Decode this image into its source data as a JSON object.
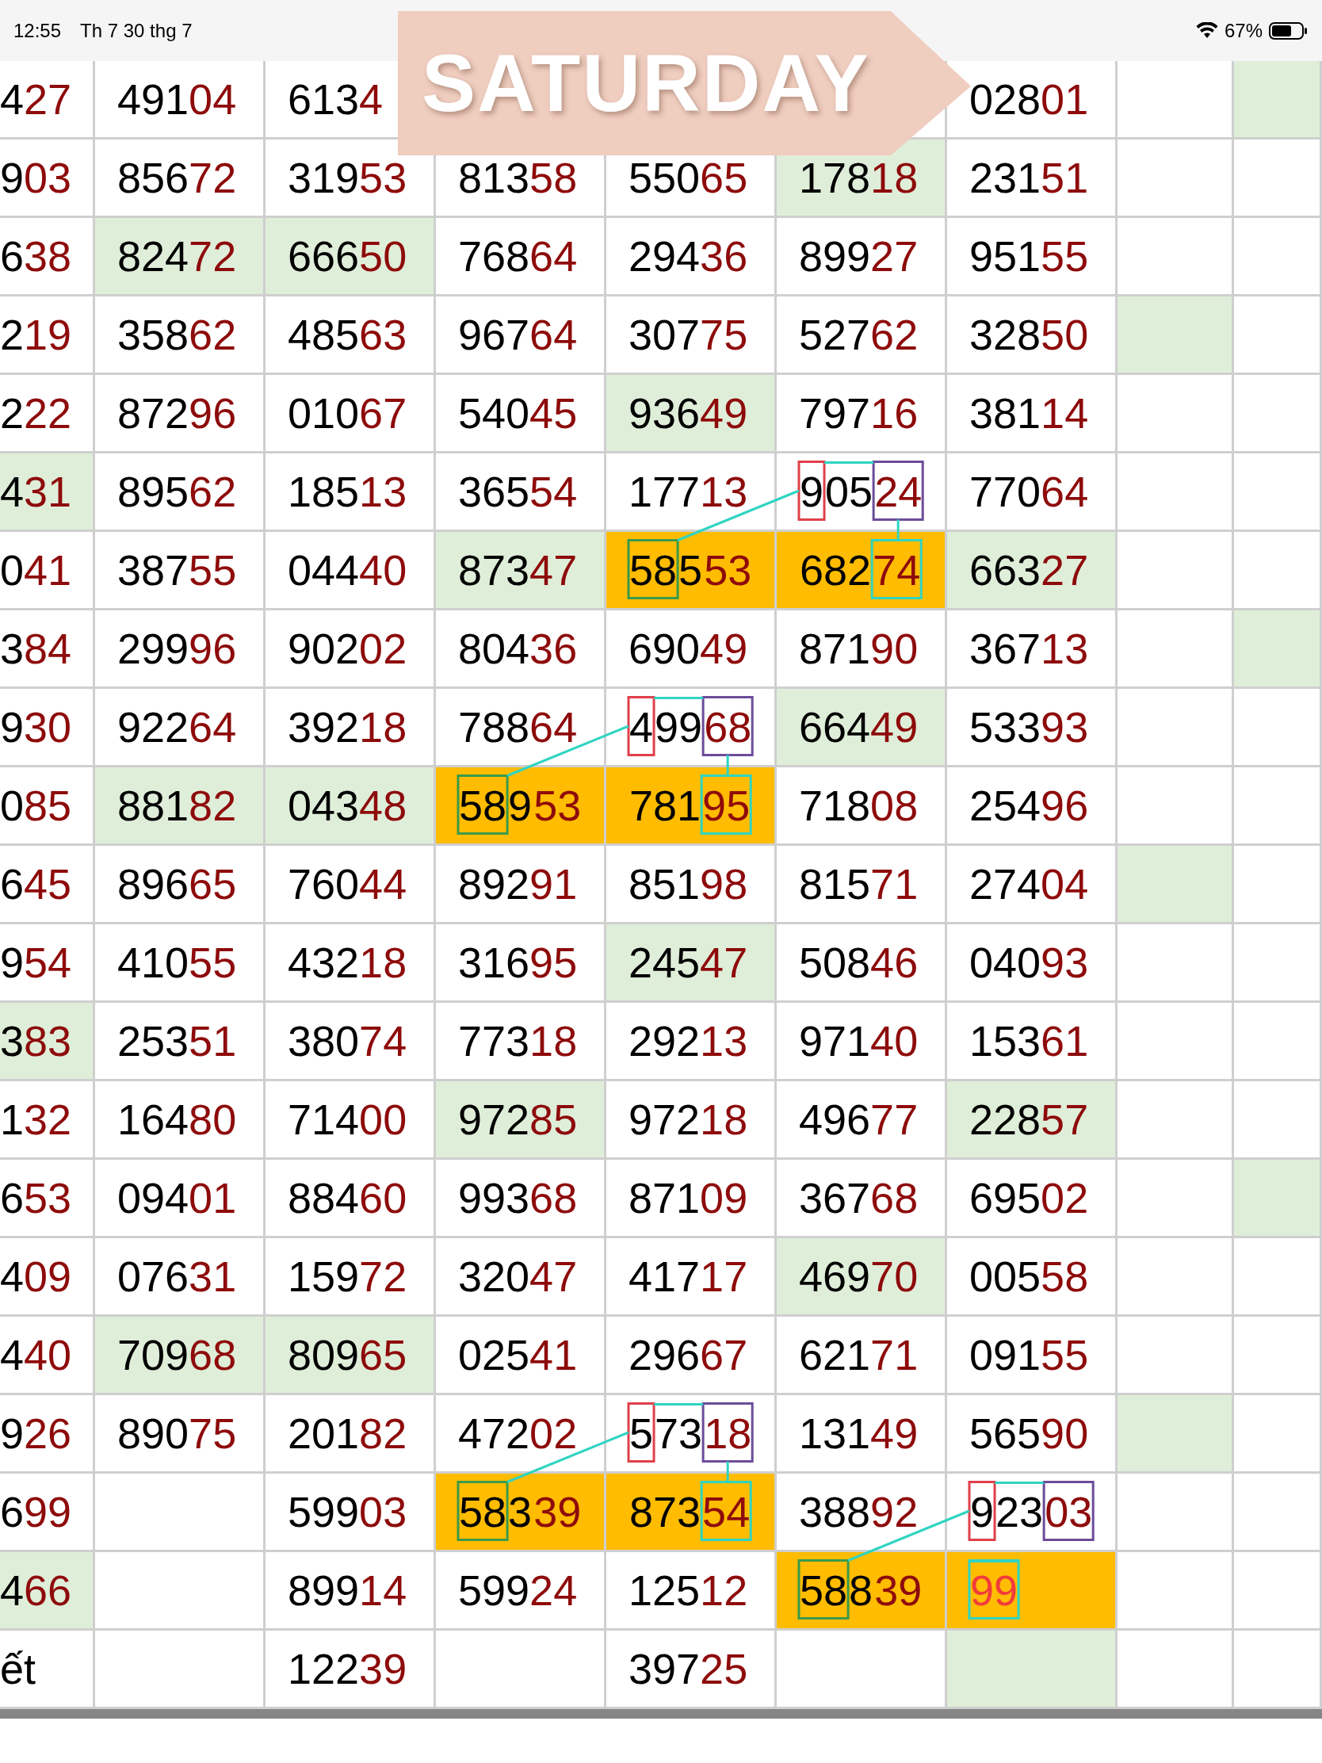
{
  "status_bar": {
    "time": "12:55",
    "date": "Th 7 30 thg 7",
    "battery": "67%"
  },
  "banner": {
    "text": "SATURDAY"
  },
  "rows": [
    {
      "cells": [
        {
          "lead": "4",
          "tail": "27"
        },
        {
          "lead": "491",
          "tail": "04"
        },
        {
          "lead": "613",
          "tail": "4"
        },
        null,
        null,
        {},
        {
          "lead": "028",
          "tail": "01"
        },
        {},
        {
          "color": "#dfeed9"
        }
      ]
    },
    {
      "cells": [
        {
          "lead": "9",
          "tail": "03"
        },
        {
          "lead": "856",
          "tail": "72"
        },
        {
          "lead": "319",
          "tail": "53"
        },
        {
          "lead": "813",
          "tail": "58"
        },
        {
          "lead": "550",
          "tail": "65"
        },
        {
          "lead": "178",
          "tail": "18",
          "color": "#dfeed9"
        },
        {
          "lead": "231",
          "tail": "51"
        },
        {},
        {}
      ]
    },
    {
      "cells": [
        {
          "lead": "6",
          "tail": "38"
        },
        {
          "lead": "824",
          "tail": "72",
          "color": "#dfeed9"
        },
        {
          "lead": "666",
          "tail": "50",
          "color": "#dfeed9"
        },
        {
          "lead": "768",
          "tail": "64"
        },
        {
          "lead": "294",
          "tail": "36"
        },
        {
          "lead": "899",
          "tail": "27"
        },
        {
          "lead": "951",
          "tail": "55"
        },
        {},
        {}
      ]
    },
    {
      "cells": [
        {
          "lead": "2",
          "tail": "19"
        },
        {
          "lead": "358",
          "tail": "62"
        },
        {
          "lead": "485",
          "tail": "63"
        },
        {
          "lead": "967",
          "tail": "64"
        },
        {
          "lead": "307",
          "tail": "75"
        },
        {
          "lead": "527",
          "tail": "62"
        },
        {
          "lead": "328",
          "tail": "50"
        },
        {
          "color": "#dfeed9"
        },
        {}
      ]
    },
    {
      "cells": [
        {
          "lead": "2",
          "tail": "22"
        },
        {
          "lead": "872",
          "tail": "96"
        },
        {
          "lead": "010",
          "tail": "67"
        },
        {
          "lead": "540",
          "tail": "45"
        },
        {
          "lead": "936",
          "tail": "49",
          "color": "#dfeed9"
        },
        {
          "lead": "797",
          "tail": "16"
        },
        {
          "lead": "381",
          "tail": "14"
        },
        {},
        {}
      ]
    },
    {
      "cells": [
        {
          "lead": "4",
          "tail": "31",
          "color": "#dfeed9"
        },
        {
          "lead": "895",
          "tail": "62"
        },
        {
          "lead": "185",
          "tail": "13"
        },
        {
          "lead": "365",
          "tail": "54"
        },
        {
          "lead": "177",
          "tail": "13"
        },
        {
          "parts": [
            {
              "text": "9",
              "color": "#000000",
              "box": {
                "color": "#e0404a"
              }
            },
            {
              "text": "05",
              "color": "#000000"
            },
            {
              "text": "24",
              "color": "#8e0b0b",
              "box": {
                "color": "#6b4c9a"
              }
            }
          ]
        },
        {
          "lead": "770",
          "tail": "64"
        },
        {},
        {}
      ]
    },
    {
      "cells": [
        {
          "lead": "0",
          "tail": "41"
        },
        {
          "lead": "387",
          "tail": "55"
        },
        {
          "lead": "044",
          "tail": "40"
        },
        {
          "lead": "873",
          "tail": "47",
          "color": "#dfeed9"
        },
        {
          "color": "#ffbc00",
          "parts": [
            {
              "text": "58",
              "color": "#000000",
              "box": {
                "color": "#3a9a4a"
              }
            },
            {
              "text": "5",
              "color": "#000000"
            },
            {
              "text": "53",
              "color": "#8e0b0b"
            }
          ]
        },
        {
          "color": "#ffbc00",
          "parts": [
            {
              "text": "682",
              "color": "#000000"
            },
            {
              "text": "74",
              "color": "#8e0b0b",
              "box": {
                "color": "#2fd4c2"
              }
            }
          ]
        },
        {
          "lead": "663",
          "tail": "27",
          "color": "#dfeed9"
        },
        {},
        {}
      ]
    },
    {
      "cells": [
        {
          "lead": "3",
          "tail": "84"
        },
        {
          "lead": "299",
          "tail": "96"
        },
        {
          "lead": "902",
          "tail": "02"
        },
        {
          "lead": "804",
          "tail": "36"
        },
        {
          "lead": "690",
          "tail": "49"
        },
        {
          "lead": "871",
          "tail": "90"
        },
        {
          "lead": "367",
          "tail": "13"
        },
        {},
        {
          "color": "#dfeed9"
        }
      ]
    },
    {
      "cells": [
        {
          "lead": "9",
          "tail": "30"
        },
        {
          "lead": "922",
          "tail": "64"
        },
        {
          "lead": "392",
          "tail": "18"
        },
        {
          "lead": "788",
          "tail": "64"
        },
        {
          "parts": [
            {
              "text": "4",
              "color": "#000000",
              "box": {
                "color": "#e0404a"
              }
            },
            {
              "text": "99",
              "color": "#000000"
            },
            {
              "text": "68",
              "color": "#8e0b0b",
              "box": {
                "color": "#6b4c9a"
              }
            }
          ]
        },
        {
          "lead": "664",
          "tail": "49",
          "color": "#dfeed9"
        },
        {
          "lead": "533",
          "tail": "93"
        },
        {},
        {}
      ]
    },
    {
      "cells": [
        {
          "lead": "0",
          "tail": "85"
        },
        {
          "lead": "881",
          "tail": "82",
          "color": "#dfeed9"
        },
        {
          "lead": "043",
          "tail": "48",
          "color": "#dfeed9"
        },
        {
          "color": "#ffbc00",
          "parts": [
            {
              "text": "58",
              "color": "#000000",
              "box": {
                "color": "#3a9a4a"
              }
            },
            {
              "text": "9",
              "color": "#000000"
            },
            {
              "text": "53",
              "color": "#8e0b0b"
            }
          ]
        },
        {
          "color": "#ffbc00",
          "parts": [
            {
              "text": "781",
              "color": "#000000"
            },
            {
              "text": "95",
              "color": "#8e0b0b",
              "box": {
                "color": "#2fd4c2"
              }
            }
          ]
        },
        {
          "lead": "718",
          "tail": "08"
        },
        {
          "lead": "254",
          "tail": "96"
        },
        {},
        {}
      ]
    },
    {
      "cells": [
        {
          "lead": "6",
          "tail": "45"
        },
        {
          "lead": "896",
          "tail": "65"
        },
        {
          "lead": "760",
          "tail": "44"
        },
        {
          "lead": "892",
          "tail": "91"
        },
        {
          "lead": "851",
          "tail": "98"
        },
        {
          "lead": "815",
          "tail": "71"
        },
        {
          "lead": "274",
          "tail": "04"
        },
        {
          "color": "#dfeed9"
        },
        {}
      ]
    },
    {
      "cells": [
        {
          "lead": "9",
          "tail": "54"
        },
        {
          "lead": "410",
          "tail": "55"
        },
        {
          "lead": "432",
          "tail": "18"
        },
        {
          "lead": "316",
          "tail": "95"
        },
        {
          "lead": "245",
          "tail": "47",
          "color": "#dfeed9"
        },
        {
          "lead": "508",
          "tail": "46"
        },
        {
          "lead": "040",
          "tail": "93"
        },
        {},
        {}
      ]
    },
    {
      "cells": [
        {
          "lead": "3",
          "tail": "83",
          "color": "#dfeed9"
        },
        {
          "lead": "253",
          "tail": "51"
        },
        {
          "lead": "380",
          "tail": "74"
        },
        {
          "lead": "773",
          "tail": "18"
        },
        {
          "lead": "292",
          "tail": "13"
        },
        {
          "lead": "971",
          "tail": "40"
        },
        {
          "lead": "153",
          "tail": "61"
        },
        {},
        {}
      ]
    },
    {
      "cells": [
        {
          "lead": "1",
          "tail": "32"
        },
        {
          "lead": "164",
          "tail": "80"
        },
        {
          "lead": "714",
          "tail": "00"
        },
        {
          "lead": "972",
          "tail": "85",
          "color": "#dfeed9"
        },
        {
          "lead": "972",
          "tail": "18"
        },
        {
          "lead": "496",
          "tail": "77"
        },
        {
          "lead": "228",
          "tail": "57",
          "color": "#dfeed9"
        },
        {},
        {}
      ]
    },
    {
      "cells": [
        {
          "lead": "6",
          "tail": "53"
        },
        {
          "lead": "094",
          "tail": "01"
        },
        {
          "lead": "884",
          "tail": "60"
        },
        {
          "lead": "993",
          "tail": "68"
        },
        {
          "lead": "871",
          "tail": "09"
        },
        {
          "lead": "367",
          "tail": "68"
        },
        {
          "lead": "695",
          "tail": "02"
        },
        {},
        {
          "color": "#dfeed9"
        }
      ]
    },
    {
      "cells": [
        {
          "lead": "4",
          "tail": "09"
        },
        {
          "lead": "076",
          "tail": "31"
        },
        {
          "lead": "159",
          "tail": "72"
        },
        {
          "lead": "320",
          "tail": "47"
        },
        {
          "lead": "417",
          "tail": "17"
        },
        {
          "lead": "469",
          "tail": "70",
          "color": "#dfeed9"
        },
        {
          "lead": "005",
          "tail": "58"
        },
        {},
        {}
      ]
    },
    {
      "cells": [
        {
          "lead": "4",
          "tail": "40"
        },
        {
          "lead": "709",
          "tail": "68",
          "color": "#dfeed9"
        },
        {
          "lead": "809",
          "tail": "65",
          "color": "#dfeed9"
        },
        {
          "lead": "025",
          "tail": "41"
        },
        {
          "lead": "296",
          "tail": "67"
        },
        {
          "lead": "621",
          "tail": "71"
        },
        {
          "lead": "091",
          "tail": "55"
        },
        {},
        {}
      ]
    },
    {
      "cells": [
        {
          "lead": "9",
          "tail": "26"
        },
        {
          "lead": "890",
          "tail": "75"
        },
        {
          "lead": "201",
          "tail": "82"
        },
        {
          "lead": "472",
          "tail": "02"
        },
        {
          "parts": [
            {
              "text": "5",
              "color": "#000000",
              "box": {
                "color": "#e0404a"
              }
            },
            {
              "text": "73",
              "color": "#000000"
            },
            {
              "text": "18",
              "color": "#8e0b0b",
              "box": {
                "color": "#6b4c9a"
              }
            }
          ]
        },
        {
          "lead": "131",
          "tail": "49"
        },
        {
          "lead": "565",
          "tail": "90"
        },
        {
          "color": "#dfeed9"
        },
        {}
      ]
    },
    {
      "cells": [
        {
          "lead": "6",
          "tail": "99"
        },
        {},
        {
          "lead": "599",
          "tail": "03"
        },
        {
          "color": "#ffbc00",
          "parts": [
            {
              "text": "58",
              "color": "#000000",
              "box": {
                "color": "#3a9a4a"
              }
            },
            {
              "text": "3",
              "color": "#000000"
            },
            {
              "text": "39",
              "color": "#8e0b0b"
            }
          ]
        },
        {
          "color": "#ffbc00",
          "parts": [
            {
              "text": "873",
              "color": "#000000"
            },
            {
              "text": "54",
              "color": "#8e0b0b",
              "box": {
                "color": "#2fd4c2"
              }
            }
          ]
        },
        {
          "lead": "388",
          "tail": "92"
        },
        {
          "parts": [
            {
              "text": "9",
              "color": "#000000",
              "box": {
                "color": "#e0404a"
              }
            },
            {
              "text": "23",
              "color": "#000000"
            },
            {
              "text": "03",
              "color": "#8e0b0b",
              "box": {
                "color": "#6b4c9a"
              }
            }
          ]
        },
        {},
        {}
      ]
    },
    {
      "cells": [
        {
          "lead": "4",
          "tail": "66",
          "color": "#dfeed9"
        },
        {},
        {
          "lead": "899",
          "tail": "14"
        },
        {
          "lead": "599",
          "tail": "24"
        },
        {
          "lead": "125",
          "tail": "12"
        },
        {
          "color": "#ffbc00",
          "parts": [
            {
              "text": "58",
              "color": "#000000",
              "box": {
                "color": "#3a9a4a"
              }
            },
            {
              "text": "8",
              "color": "#000000"
            },
            {
              "text": "39",
              "color": "#8e0b0b"
            }
          ]
        },
        {
          "color": "#ffbc00",
          "parts": [
            {
              "text": "99",
              "color": "#f23b3b",
              "box": {
                "color": "#2fd4c2"
              }
            }
          ]
        },
        {},
        {}
      ]
    },
    {
      "cells": [
        {
          "lead": "ết"
        },
        {},
        {
          "lead": "122",
          "tail": "39"
        },
        {},
        {
          "lead": "397",
          "tail": "25"
        },
        {},
        {
          "color": "#dfeed9"
        },
        {},
        {}
      ]
    }
  ]
}
